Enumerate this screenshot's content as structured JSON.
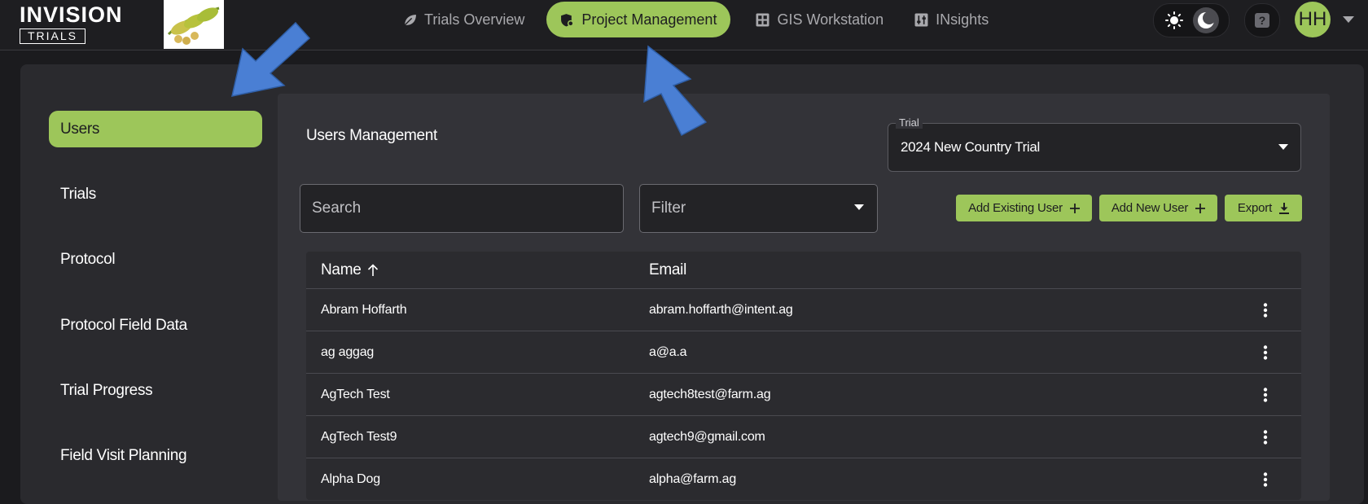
{
  "brand": {
    "name": "INVISION",
    "sub": "TRIALS"
  },
  "nav": {
    "items": [
      {
        "label": "Trials Overview",
        "icon": "leaf-icon",
        "active": false
      },
      {
        "label": "Project Management",
        "icon": "shield-gear-icon",
        "active": true
      },
      {
        "label": "GIS Workstation",
        "icon": "grid-icon",
        "active": false
      },
      {
        "label": "INsights",
        "icon": "sliders-icon",
        "active": false
      }
    ]
  },
  "user": {
    "initials": "HH"
  },
  "help": {
    "label": "?"
  },
  "sidebar": {
    "items": [
      {
        "label": "Users",
        "active": true
      },
      {
        "label": "Trials",
        "active": false
      },
      {
        "label": "Protocol",
        "active": false
      },
      {
        "label": "Protocol Field Data",
        "active": false
      },
      {
        "label": "Trial Progress",
        "active": false
      },
      {
        "label": "Field Visit Planning",
        "active": false
      }
    ]
  },
  "main": {
    "title": "Users Management",
    "trial_select": {
      "legend": "Trial",
      "value": "2024 New Country Trial"
    },
    "search": {
      "placeholder": "Search"
    },
    "filter": {
      "placeholder": "Filter"
    },
    "buttons": {
      "add_existing": "Add Existing User",
      "add_new": "Add New User",
      "export": "Export"
    }
  },
  "table": {
    "columns": {
      "name": "Name",
      "email": "Email"
    },
    "rows": [
      {
        "name": "Abram Hoffarth",
        "email": "abram.hoffarth@intent.ag"
      },
      {
        "name": "ag aggag",
        "email": "a@a.a"
      },
      {
        "name": "AgTech Test",
        "email": "agtech8test@farm.ag"
      },
      {
        "name": "AgTech Test9",
        "email": "agtech9@gmail.com"
      },
      {
        "name": "Alpha Dog",
        "email": "alpha@farm.ag"
      }
    ]
  },
  "colors": {
    "accent": "#9dc65a",
    "background": "#1b1b1e",
    "panel": "#2a2a2e",
    "annotation": "#4a7fd4"
  }
}
